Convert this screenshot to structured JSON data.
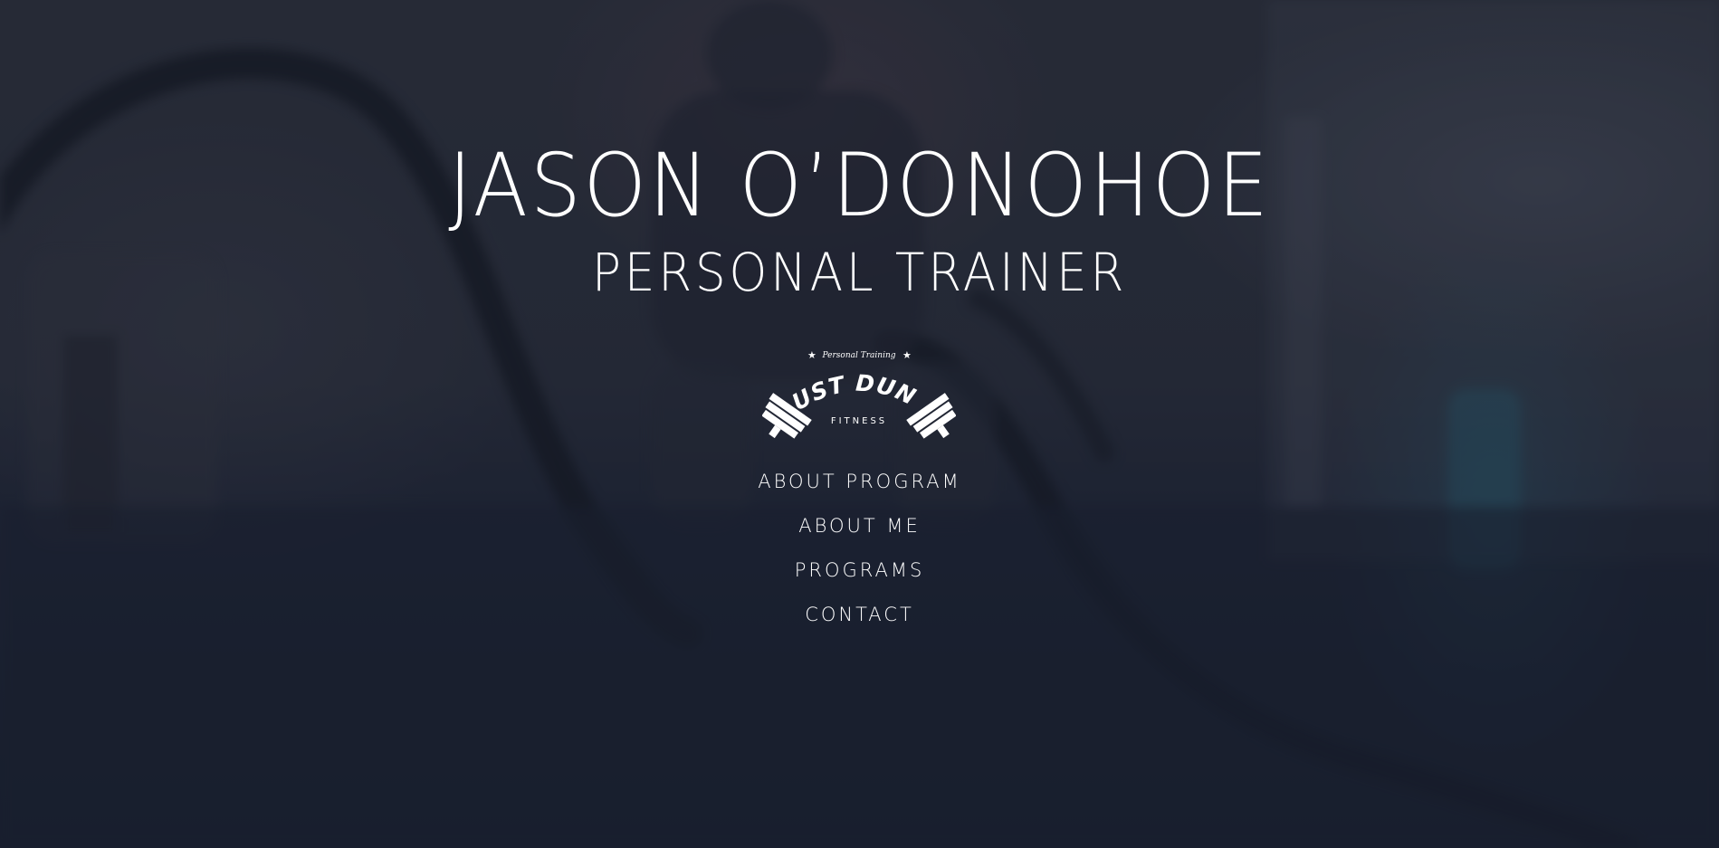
{
  "hero": {
    "name": "JASON O’DONOHOE",
    "subtitle": "PERSONAL TRAINER"
  },
  "logo": {
    "top_text": "Personal Training",
    "brand": "JUST DUNN",
    "sub": "FITNESS",
    "icon": "barbell-logo-icon"
  },
  "nav": {
    "items": [
      {
        "label": "ABOUT PROGRAM"
      },
      {
        "label": "ABOUT ME"
      },
      {
        "label": "PROGRAMS"
      },
      {
        "label": "CONTACT"
      }
    ]
  },
  "colors": {
    "text": "#ffffff",
    "overlay": "#161c2c"
  }
}
